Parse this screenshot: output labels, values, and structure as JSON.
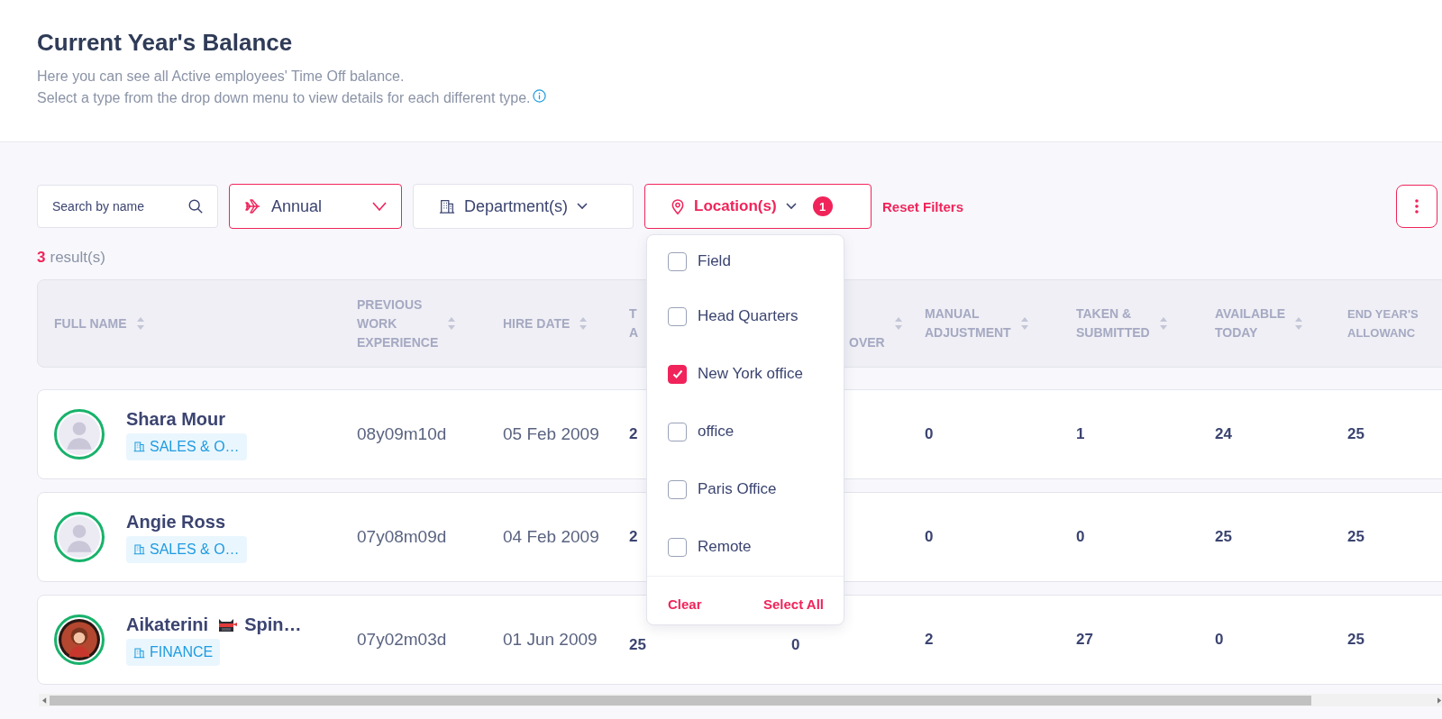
{
  "header": {
    "title": "Current Year's Balance",
    "description_lines": [
      "Here you can see all Active employees' Time Off balance.",
      "Select a type from the drop down menu to view details for each different type."
    ]
  },
  "filters": {
    "search": {
      "placeholder": "Search by name"
    },
    "type": {
      "value": "Annual"
    },
    "department": {
      "label": "Department(s)"
    },
    "location": {
      "label": "Location(s)",
      "count": "1",
      "expanded": true,
      "options": [
        {
          "label": "Field",
          "checked": false
        },
        {
          "label": "Head Quarters",
          "checked": false
        },
        {
          "label": "New York office",
          "checked": true
        },
        {
          "label": "office",
          "checked": false
        },
        {
          "label": "Paris Office",
          "checked": false
        },
        {
          "label": "Remote",
          "checked": false
        }
      ],
      "actions": [
        "Clear",
        "Select All"
      ]
    },
    "reset": "Reset Filters"
  },
  "results": {
    "count": "3",
    "label": "result(s)"
  },
  "table": {
    "columns": [
      {
        "lines": [
          "FULL NAME"
        ]
      },
      {
        "lines": [
          "PREVIOUS",
          "WORK",
          "EXPERIENCE"
        ]
      },
      {
        "lines": [
          "HIRE DATE"
        ]
      },
      {
        "lines": [
          "T",
          "A"
        ]
      },
      {
        "lines": [
          "OVER"
        ]
      },
      {
        "lines": [
          "MANUAL",
          "ADJUSTMENT"
        ]
      },
      {
        "lines": [
          "TAKEN &",
          "SUBMITTED"
        ]
      },
      {
        "lines": [
          "AVAILABLE",
          "TODAY"
        ]
      },
      {
        "lines": [
          "END YEAR'S",
          "ALLOWANC"
        ]
      }
    ],
    "rows": [
      {
        "name_parts": [
          "Shara Mour"
        ],
        "kind": "silhouette",
        "department": "SALES & O…",
        "work_experience": "08y09m10d",
        "hire_date": "05 Feb 2009",
        "column_4": "2",
        "manual_adjustment": "0",
        "taken_submitted": "1",
        "available_today": "24",
        "end_year_allowance": "25"
      },
      {
        "name_parts": [
          "Angie Ross"
        ],
        "kind": "silhouette",
        "department": "SALES & O…",
        "work_experience": "07y08m09d",
        "hire_date": "04 Feb 2009",
        "column_4": "2",
        "manual_adjustment": "0",
        "taken_submitted": "0",
        "available_today": "25",
        "end_year_allowance": "25"
      },
      {
        "name_parts": [
          "Aikaterini",
          "Spin…"
        ],
        "kind": "picture",
        "department": "FINANCE",
        "work_experience": "07y02m03d",
        "hire_date": "01 Jun 2009",
        "column_4": "25",
        "column_5": "0",
        "manual_adjustment": "2",
        "taken_submitted": "27",
        "available_today": "0",
        "end_year_allowance": "25"
      }
    ]
  }
}
